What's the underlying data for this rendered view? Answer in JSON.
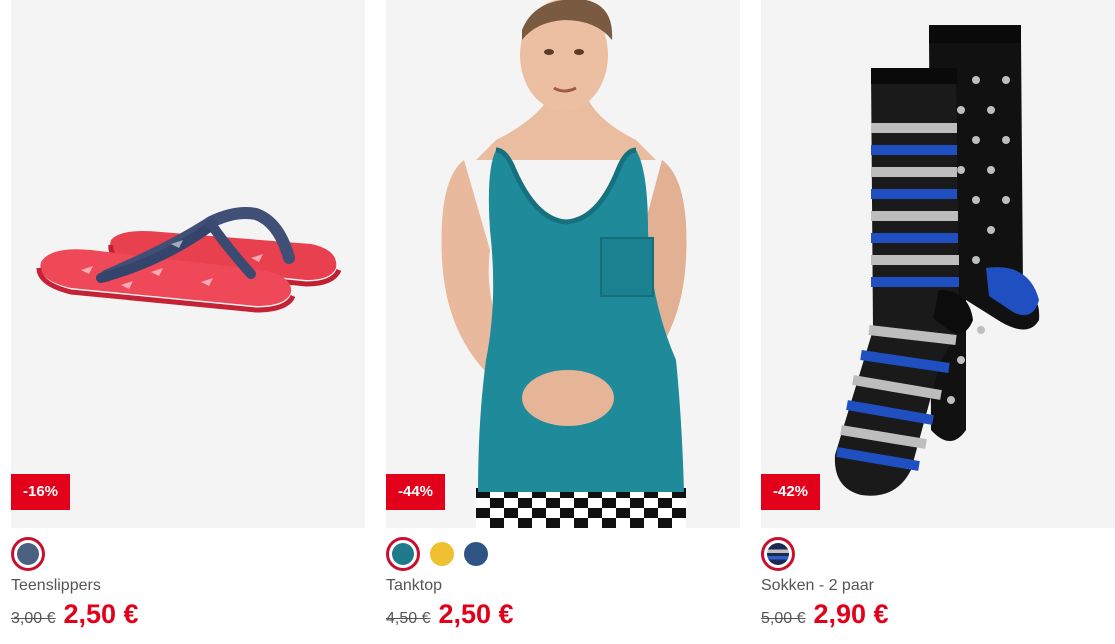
{
  "products": [
    {
      "name": "Teenslippers",
      "discount": "-16%",
      "old_price": "3,00 €",
      "new_price": "2,50 €",
      "colors": [
        "#4a6080"
      ]
    },
    {
      "name": "Tanktop",
      "discount": "-44%",
      "old_price": "4,50 €",
      "new_price": "2,50 €",
      "colors": [
        "#1f7a8c",
        "#f0c030",
        "#2f5585"
      ]
    },
    {
      "name": "Sokken - 2 paar",
      "discount": "-42%",
      "old_price": "5,00 €",
      "new_price": "2,90 €",
      "colors": [
        "#1a2a55"
      ]
    }
  ],
  "theme": {
    "accent": "#e2001a",
    "selected_ring": "#c8102e"
  }
}
